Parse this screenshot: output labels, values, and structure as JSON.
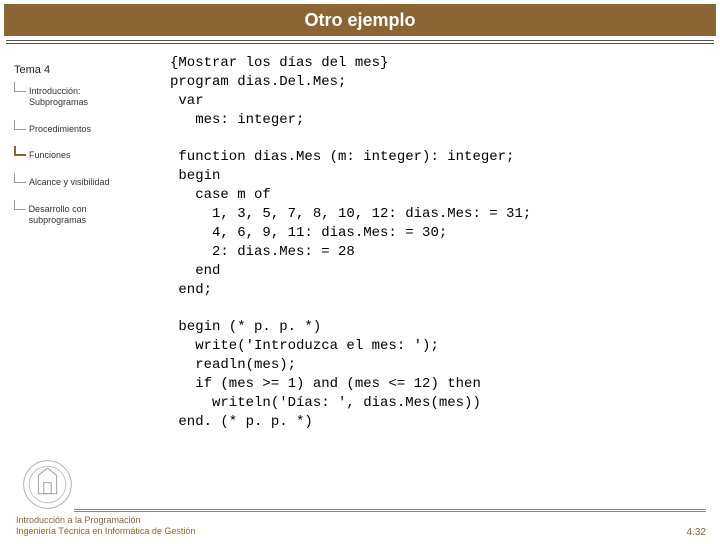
{
  "title": "Otro ejemplo",
  "sidebar": {
    "heading": "Tema 4",
    "items": [
      {
        "label": "Introducción:\nSubprogramas",
        "active": false
      },
      {
        "label": "Procedimientos",
        "active": false
      },
      {
        "label": "Funciones",
        "active": true
      },
      {
        "label": "Alcance y\nvisibilidad",
        "active": false
      },
      {
        "label": "Desarrollo con\nsubprogramas",
        "active": false
      }
    ]
  },
  "code": "{Mostrar los días del mes}\nprogram dias.Del.Mes;\n var\n   mes: integer;\n\n function dias.Mes (m: integer): integer;\n begin\n   case m of\n     1, 3, 5, 7, 8, 10, 12: dias.Mes: = 31;\n     4, 6, 9, 11: dias.Mes: = 30;\n     2: dias.Mes: = 28\n   end\n end;\n\n begin (* p. p. *)\n   write('Introduzca el mes: ');\n   readln(mes);\n   if (mes >= 1) and (mes <= 12) then\n     writeln('Días: ', dias.Mes(mes))\n end. (* p. p. *)",
  "footer": {
    "line1": "Introducción a la Programación",
    "line2": "Ingeniería Técnica en Informática de Gestión",
    "page": "4.32"
  }
}
